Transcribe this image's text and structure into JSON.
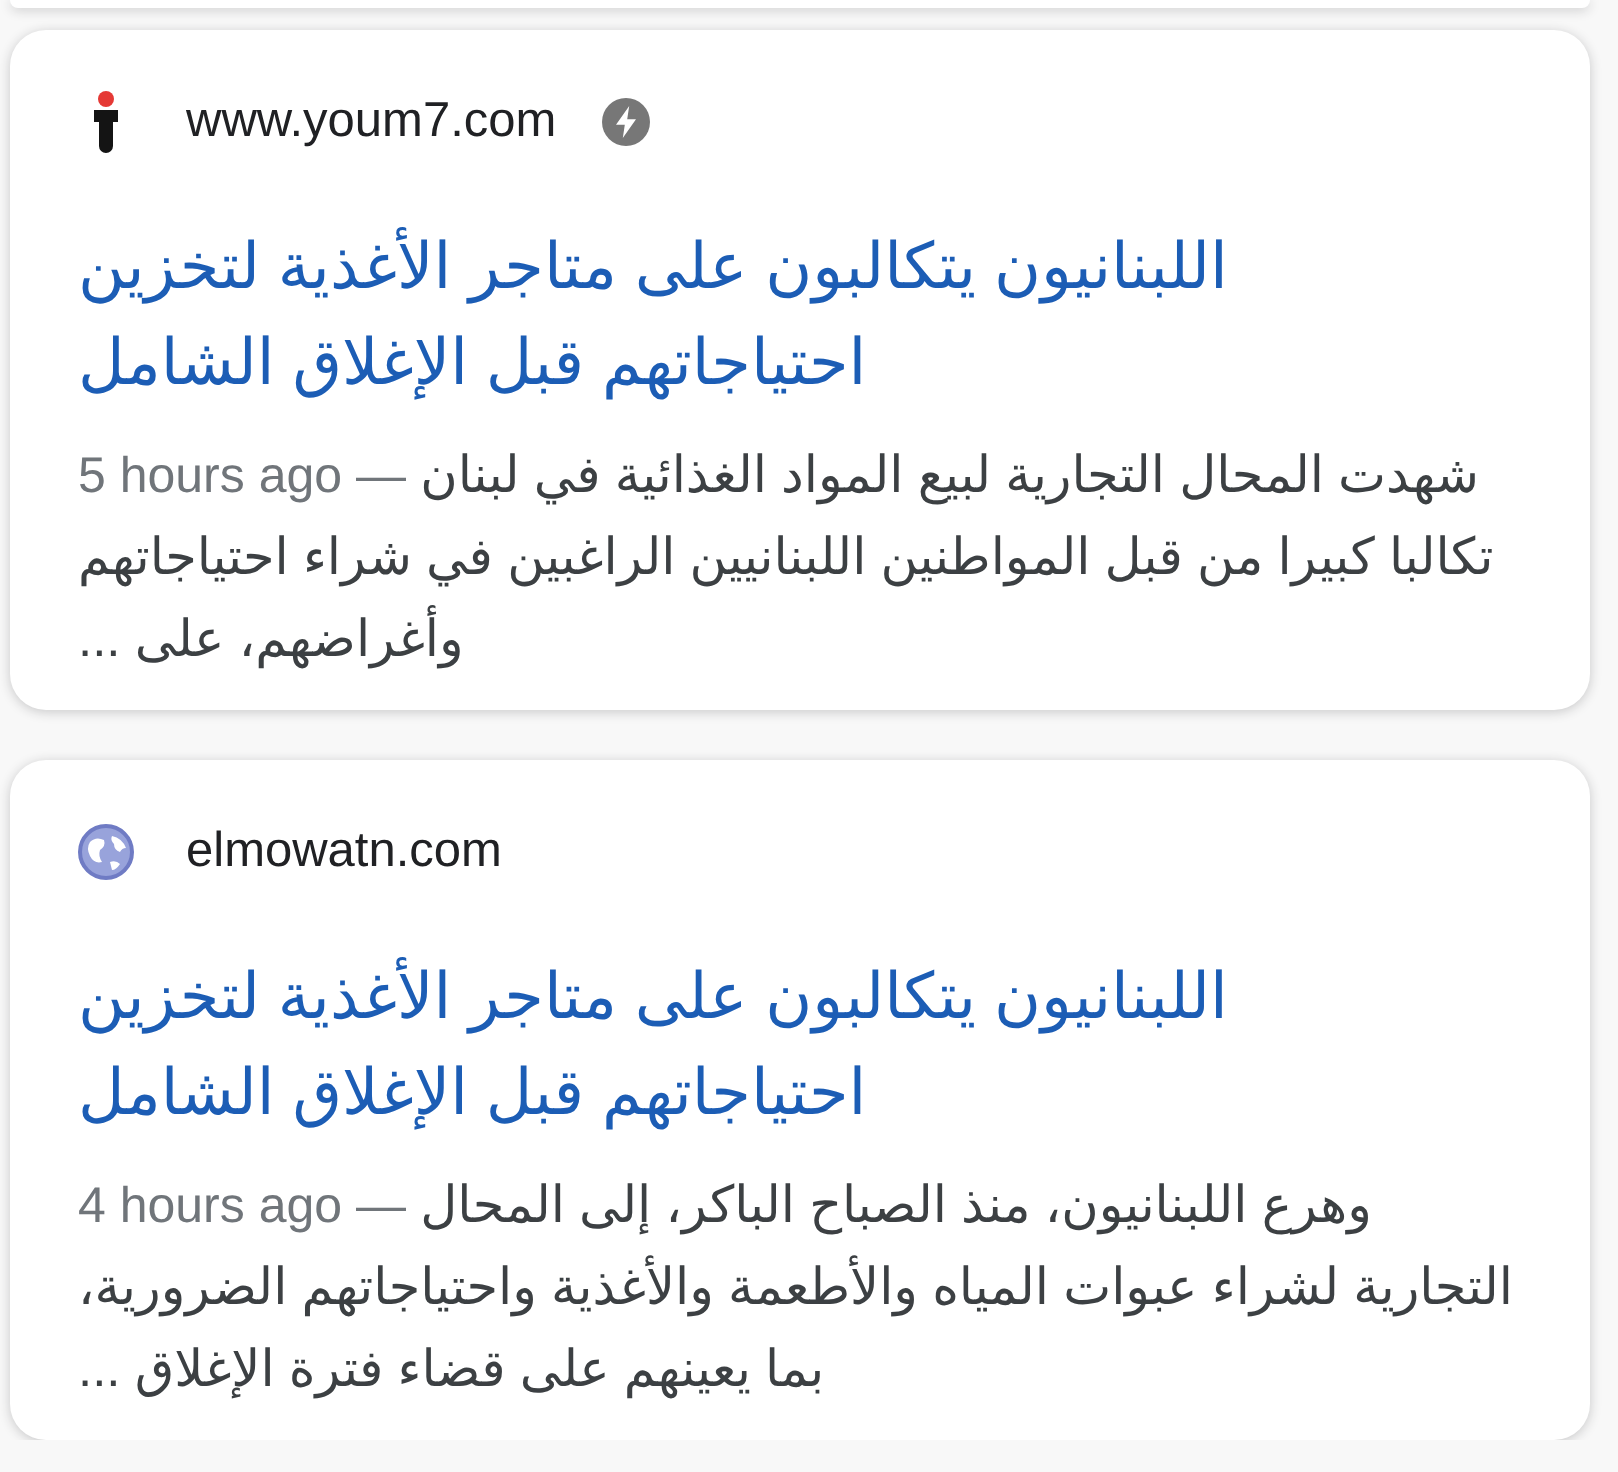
{
  "results": [
    {
      "favicon": {
        "kind": "logo"
      },
      "site": "www.youm7.com",
      "amp": true,
      "title": "اللبنانيون يتكالبون على متاجر الأغذية لتخزين احتياجاتهم قبل الإغلاق الشامل",
      "date": "5 hours ago —",
      "snippet": "شهدت المحال التجارية لبيع المواد الغذائية في لبنان تكالبا كبيرا من قبل المواطنين اللبنانيين الراغبين في شراء احتياجاتهم وأغراضهم، على ..."
    },
    {
      "favicon": {
        "kind": "globe"
      },
      "site": "elmowatn.com",
      "amp": false,
      "title": "اللبنانيون يتكالبون على متاجر الأغذية لتخزين احتياجاتهم قبل الإغلاق الشامل",
      "date": "4 hours ago —",
      "snippet": "وهرع اللبنانيون، منذ الصباح الباكر، إلى المحال التجارية لشراء عبوات المياه والأطعمة والأغذية واحتياجاتهم الضرورية، بما يعينهم على قضاء فترة الإغلاق ..."
    }
  ]
}
